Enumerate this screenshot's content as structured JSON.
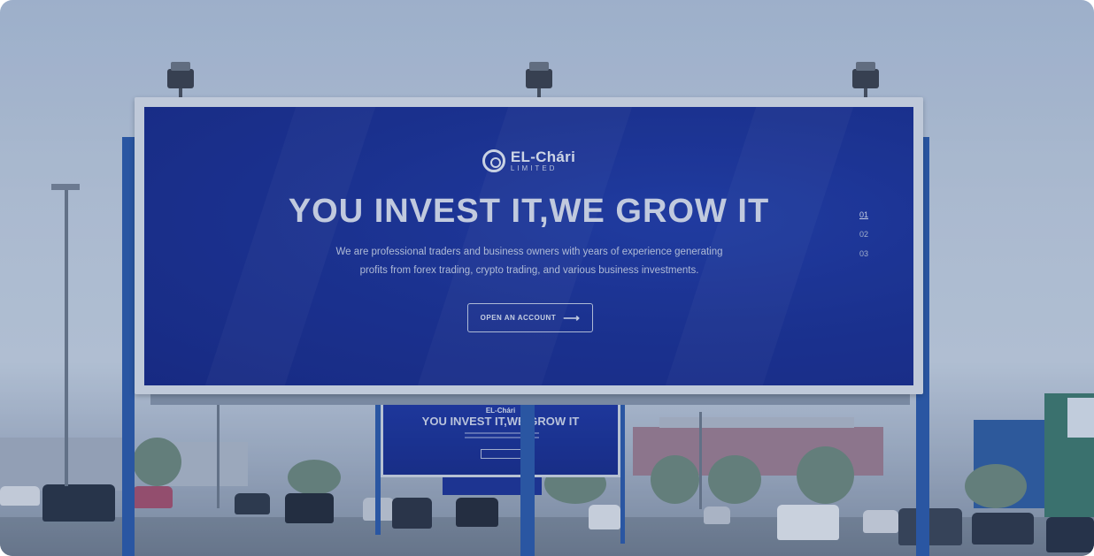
{
  "billboard": {
    "logo_name": "EL-Chári",
    "logo_sub": "LIMITED",
    "headline": "YOU INVEST IT,WE GROW IT",
    "subtext_line1": "We are professional traders and business owners with years of experience generating",
    "subtext_line2": "profits from forex trading, crypto trading, and various business investments.",
    "cta_label": "OPEN AN ACCOUNT",
    "cta_arrow": "⟶",
    "pager": [
      "01",
      "02",
      "03"
    ],
    "pager_active_index": 0
  },
  "small_billboard": {
    "logo_name": "EL-Chári",
    "headline": "YOU INVEST IT,WE GROW IT"
  },
  "colors": {
    "billboard_blue": "#1a2f93",
    "pole_blue": "#2b5aa8",
    "sky": "#c4d0de",
    "tint": "#264484"
  },
  "icons": [
    "logo-mark-icon",
    "arrow-right-icon",
    "floodlight-icon"
  ]
}
